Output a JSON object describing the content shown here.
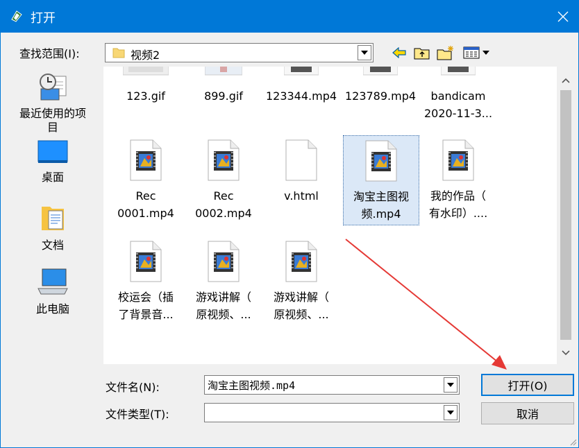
{
  "window": {
    "title": "打开"
  },
  "lookin": {
    "label": "查找范围(I):",
    "value": "视频2"
  },
  "places": [
    {
      "label": "最近使用的项\n目",
      "icon": "recent-places-icon"
    },
    {
      "label": "桌面",
      "icon": "desktop-icon"
    },
    {
      "label": "文档",
      "icon": "documents-icon"
    },
    {
      "label": "此电脑",
      "icon": "this-pc-icon"
    }
  ],
  "files": [
    {
      "label": "123.gif",
      "type": "gif"
    },
    {
      "label": "899.gif",
      "type": "gif"
    },
    {
      "label": "123344.mp4",
      "type": "video"
    },
    {
      "label": "123789.mp4",
      "type": "video"
    },
    {
      "label": "bandicam\n2020-11-3...",
      "type": "video"
    },
    {
      "label": "Rec\n0001.mp4",
      "type": "video"
    },
    {
      "label": "Rec\n0002.mp4",
      "type": "video"
    },
    {
      "label": "v.html",
      "type": "html"
    },
    {
      "label": "淘宝主图视\n频.mp4",
      "type": "video",
      "selected": true
    },
    {
      "label": "我的作品（\n有水印）....",
      "type": "video"
    },
    {
      "label": "校运会（插\n了背景音...",
      "type": "video"
    },
    {
      "label": "游戏讲解（\n原视频、...",
      "type": "video"
    },
    {
      "label": "游戏讲解（\n原视频、...",
      "type": "video"
    }
  ],
  "filename": {
    "label": "文件名(N):",
    "value": "淘宝主图视频.mp4"
  },
  "filetype": {
    "label": "文件类型(T):",
    "value": ""
  },
  "buttons": {
    "open": "打开(O)",
    "cancel": "取消"
  },
  "colors": {
    "titlebar": "#0078d7",
    "selection": "#dbe8f7",
    "arrow": "#e53935"
  }
}
